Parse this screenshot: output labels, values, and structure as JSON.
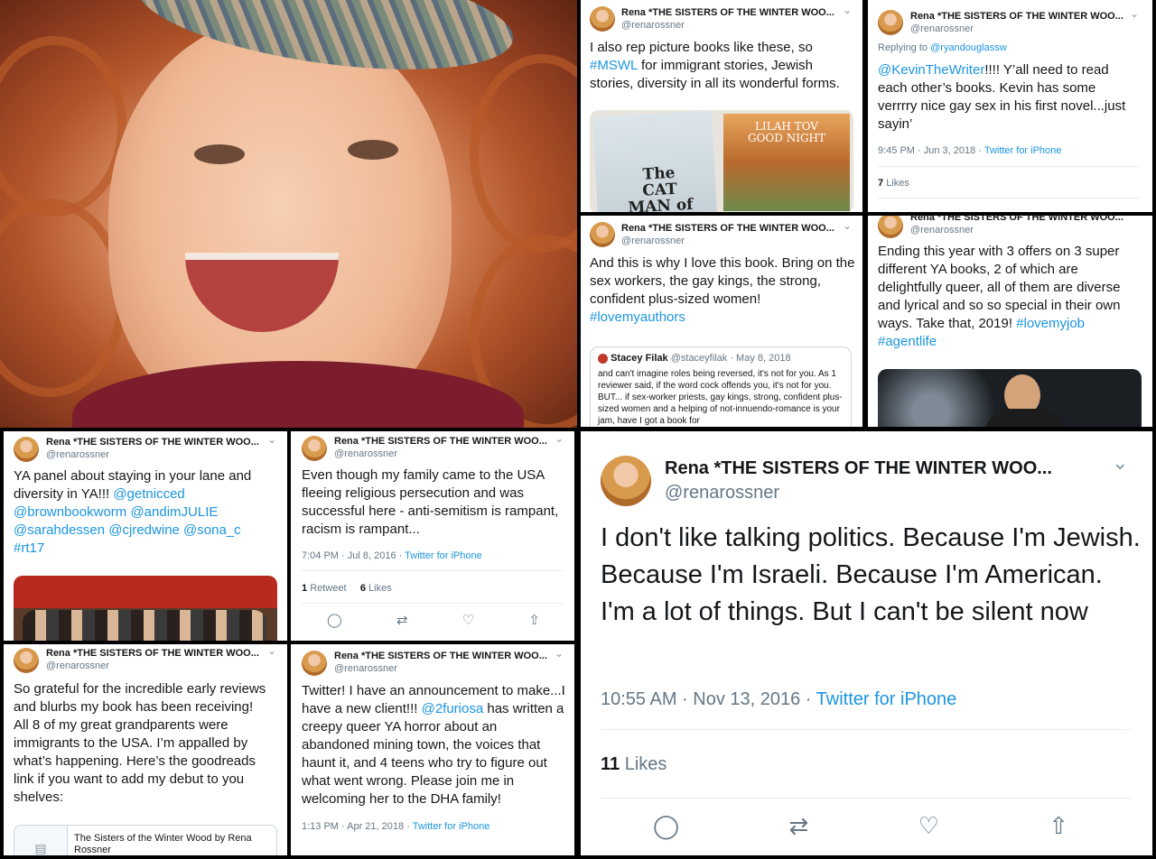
{
  "author": {
    "name": "Rena *THE SISTERS OF THE WINTER WOO...",
    "handle": "@renarossner"
  },
  "photo": {
    "alt": ""
  },
  "tweets": {
    "t_mswl": {
      "text": "I also rep picture books like these, so",
      "hashtag": "#MSWL",
      "text2": " for immigrant stories, Jewish stories, diversity in all its wonderful forms.",
      "book1_title": "The CAT MAN of ALEPPO",
      "book2_title": "LILAH TOV GOOD NIGHT"
    },
    "t_reply": {
      "replying_label": "Replying to",
      "replying_to": "@ryandouglassw",
      "mention": "@KevinTheWriter",
      "text": "!!!! Y’all need to read each other’s books. Kevin has some verrrry nice gay sex in his first novel...just sayin’",
      "time": "9:45 PM · Jun 3, 2018",
      "source": "Twitter for iPhone",
      "likes_count": "7",
      "likes_label": "Likes"
    },
    "t_sexworkers": {
      "text": "And this is why I love this book. Bring on the sex workers, the gay kings, the strong, confident plus-sized women!",
      "hashtag": "#lovemyauthors",
      "quote_name": "Stacey Filak",
      "quote_handle": "@staceyfilak",
      "quote_date": "· May 8, 2018",
      "quote_text": "and can't imagine roles being reversed, it's not for you. As 1 reviewer said, if the word cock offends you, it's not for you. BUT... if sex-worker priests, gay kings, strong, confident plus-sized women and a helping of not-innuendo-romance is your jam, have I got a book for"
    },
    "t_offers": {
      "text": "Ending this year with 3 offers on 3 super different YA books, 2 of which are delightfully queer, all of them are diverse and lyrical and so so special in their own ways. Take that, 2019!",
      "hashtag1": "#lovemyjob",
      "hashtag2": "#agentlife"
    },
    "t_panel": {
      "text": "YA panel about staying in your lane and diversity in YA!!!",
      "mentions": "@getnicced @brownbookworm @andimJULIE @sarahdessen @cjredwine @sona_c #rt17"
    },
    "t_family": {
      "text": "Even though my family came to the USA fleeing religious persecution and was successful here - anti-semitism is rampant, racism is rampant...",
      "time": "7:04 PM · Jul 8, 2016",
      "source": "Twitter for iPhone",
      "retweets_count": "1",
      "retweets_label": "Retweet",
      "likes_count": "6",
      "likes_label": "Likes"
    },
    "t_grateful": {
      "text": "So grateful for the incredible early reviews and blurbs my book has been receiving! All 8 of my great grandparents were immigrants to the USA. I’m appalled by what’s happening. Here’s the goodreads link if you want to add my debut to you shelves:",
      "card_title": "The Sisters of the Winter Wood by Rena Rossner"
    },
    "t_client": {
      "text": "Twitter! I have an announcement to make...I have a new client!!!",
      "mention": "@2furiosa",
      "text2": " has written a creepy queer YA horror about an abandoned mining town, the voices that haunt it, and 4 teens who try to figure out what went wrong. Please join me in welcoming her to the DHA family!",
      "time": "1:13 PM · Apr 21, 2018",
      "source": "Twitter for iPhone"
    },
    "t_politics": {
      "text": "I don't like talking politics. Because I'm Jewish. Because I'm Israeli. Because I'm American. I'm a lot of things. But I can't be silent now",
      "time": "10:55 AM · Nov 13, 2016",
      "source": "Twitter for iPhone",
      "likes_count": "11",
      "likes_label": "Likes"
    }
  },
  "icons": [
    "reply-icon",
    "retweet-icon",
    "like-icon",
    "share-icon",
    "chevron-down-icon",
    "document-icon"
  ],
  "colors": {
    "link": "#1b95e0",
    "muted": "#657786",
    "text": "#14171a",
    "border": "#e6ecf0"
  }
}
